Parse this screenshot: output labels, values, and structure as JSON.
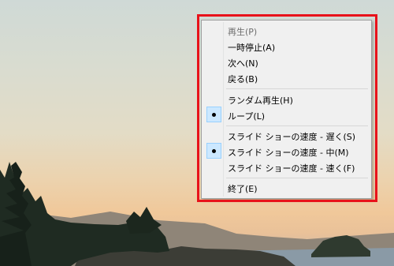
{
  "menu": {
    "items": [
      {
        "label": "再生(P)",
        "enabled": false,
        "checked": false
      },
      {
        "label": "一時停止(A)",
        "enabled": true,
        "checked": false
      },
      {
        "label": "次へ(N)",
        "enabled": true,
        "checked": false
      },
      {
        "label": "戻る(B)",
        "enabled": true,
        "checked": false
      },
      {
        "label": "ランダム再生(H)",
        "enabled": true,
        "checked": false
      },
      {
        "label": "ループ(L)",
        "enabled": true,
        "checked": true
      },
      {
        "label": "スライド ショーの速度 - 遅く(S)",
        "enabled": true,
        "checked": false
      },
      {
        "label": "スライド ショーの速度 - 中(M)",
        "enabled": true,
        "checked": true
      },
      {
        "label": "スライド ショーの速度 - 速く(F)",
        "enabled": true,
        "checked": false
      },
      {
        "label": "終了(E)",
        "enabled": true,
        "checked": false
      }
    ]
  },
  "colors": {
    "highlight_border": "#e8121a",
    "check_bg": "#cce8ff",
    "menu_bg": "#f0f0f0"
  }
}
